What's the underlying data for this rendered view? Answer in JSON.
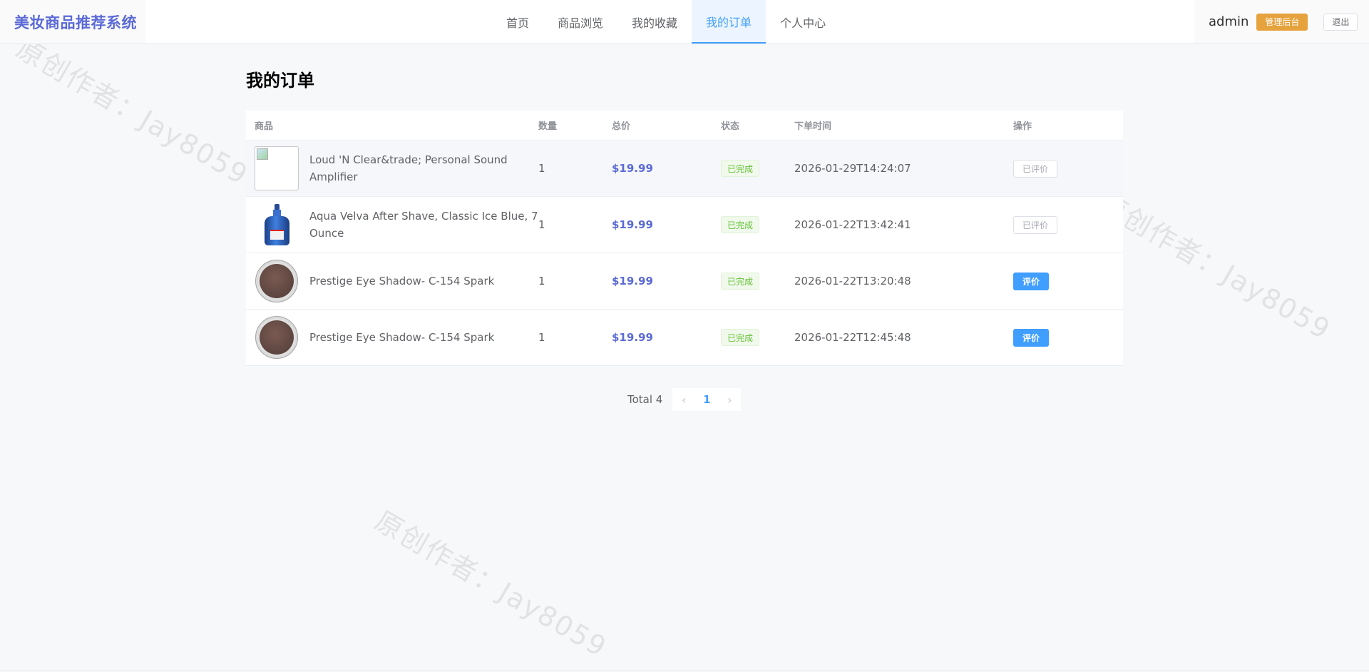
{
  "header": {
    "brand": "美妆商品推荐系统",
    "nav": [
      {
        "label": "首页",
        "active": false
      },
      {
        "label": "商品浏览",
        "active": false
      },
      {
        "label": "我的收藏",
        "active": false
      },
      {
        "label": "我的订单",
        "active": true
      },
      {
        "label": "个人中心",
        "active": false
      }
    ],
    "username": "admin",
    "admin_label": "管理后台",
    "logout_label": "退出"
  },
  "watermark": "原创作者：Jay8059",
  "page": {
    "title": "我的订单"
  },
  "table": {
    "columns": [
      "商品",
      "数量",
      "总价",
      "状态",
      "下单时间",
      "操作"
    ],
    "rows": [
      {
        "image": "broken-image",
        "name": "Loud 'N Clear&trade; Personal Sound Amplifier",
        "quantity": "1",
        "total": "$19.99",
        "status": "已完成",
        "time": "2026-01-29T14:24:07",
        "action": "已评价",
        "reviewed": true
      },
      {
        "image": "after-shave-bottle",
        "name": "Aqua Velva After Shave, Classic Ice Blue, 7 Ounce",
        "quantity": "1",
        "total": "$19.99",
        "status": "已完成",
        "time": "2026-01-22T13:42:41",
        "action": "已评价",
        "reviewed": true
      },
      {
        "image": "eye-shadow-pan",
        "name": "Prestige Eye Shadow- C-154 Spark",
        "quantity": "1",
        "total": "$19.99",
        "status": "已完成",
        "time": "2026-01-22T13:20:48",
        "action": "评价",
        "reviewed": false
      },
      {
        "image": "eye-shadow-pan",
        "name": "Prestige Eye Shadow- C-154 Spark",
        "quantity": "1",
        "total": "$19.99",
        "status": "已完成",
        "time": "2026-01-22T12:45:48",
        "action": "评价",
        "reviewed": false
      }
    ]
  },
  "pagination": {
    "total_label": "Total 4",
    "current_page": "1",
    "prev_icon": "chevron-left-icon",
    "next_icon": "chevron-right-icon"
  },
  "colors": {
    "brand": "#5b6ad6",
    "primary": "#409eff",
    "warning": "#e6a23c",
    "success": "#67c23a",
    "price": "#5b6ad6"
  }
}
